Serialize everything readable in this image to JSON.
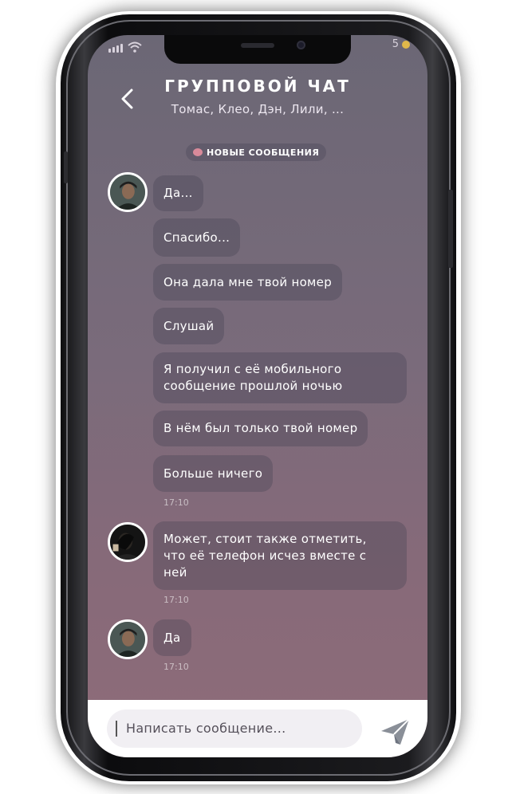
{
  "status_bar": {
    "battery_text": "5"
  },
  "header": {
    "title": "ГРУППОВОЙ ЧАТ",
    "subtitle": "Томас, Клео, Дэн, Лили, ..."
  },
  "new_messages_label": "НОВЫЕ СООБЩЕНИЯ",
  "messages": [
    {
      "text": "Да..."
    },
    {
      "text": "Спасибо..."
    },
    {
      "text": "Она дала мне твой номер"
    },
    {
      "text": "Слушай"
    },
    {
      "text": "Я получил с её мобильного\nсообщение прошлой ночью"
    },
    {
      "text": "В нём был только твой номер"
    },
    {
      "text": "Больше ничего",
      "time": "17:10"
    },
    {
      "text": "Может, стоит также отметить,\nчто её телефон исчез вместе с\nней",
      "time": "17:10"
    },
    {
      "text": "Да",
      "time": "17:10"
    }
  ],
  "composer": {
    "placeholder": "Написать сообщение..."
  },
  "colors": {
    "accent": "#d88a9a",
    "battery": "#e0b84a"
  }
}
